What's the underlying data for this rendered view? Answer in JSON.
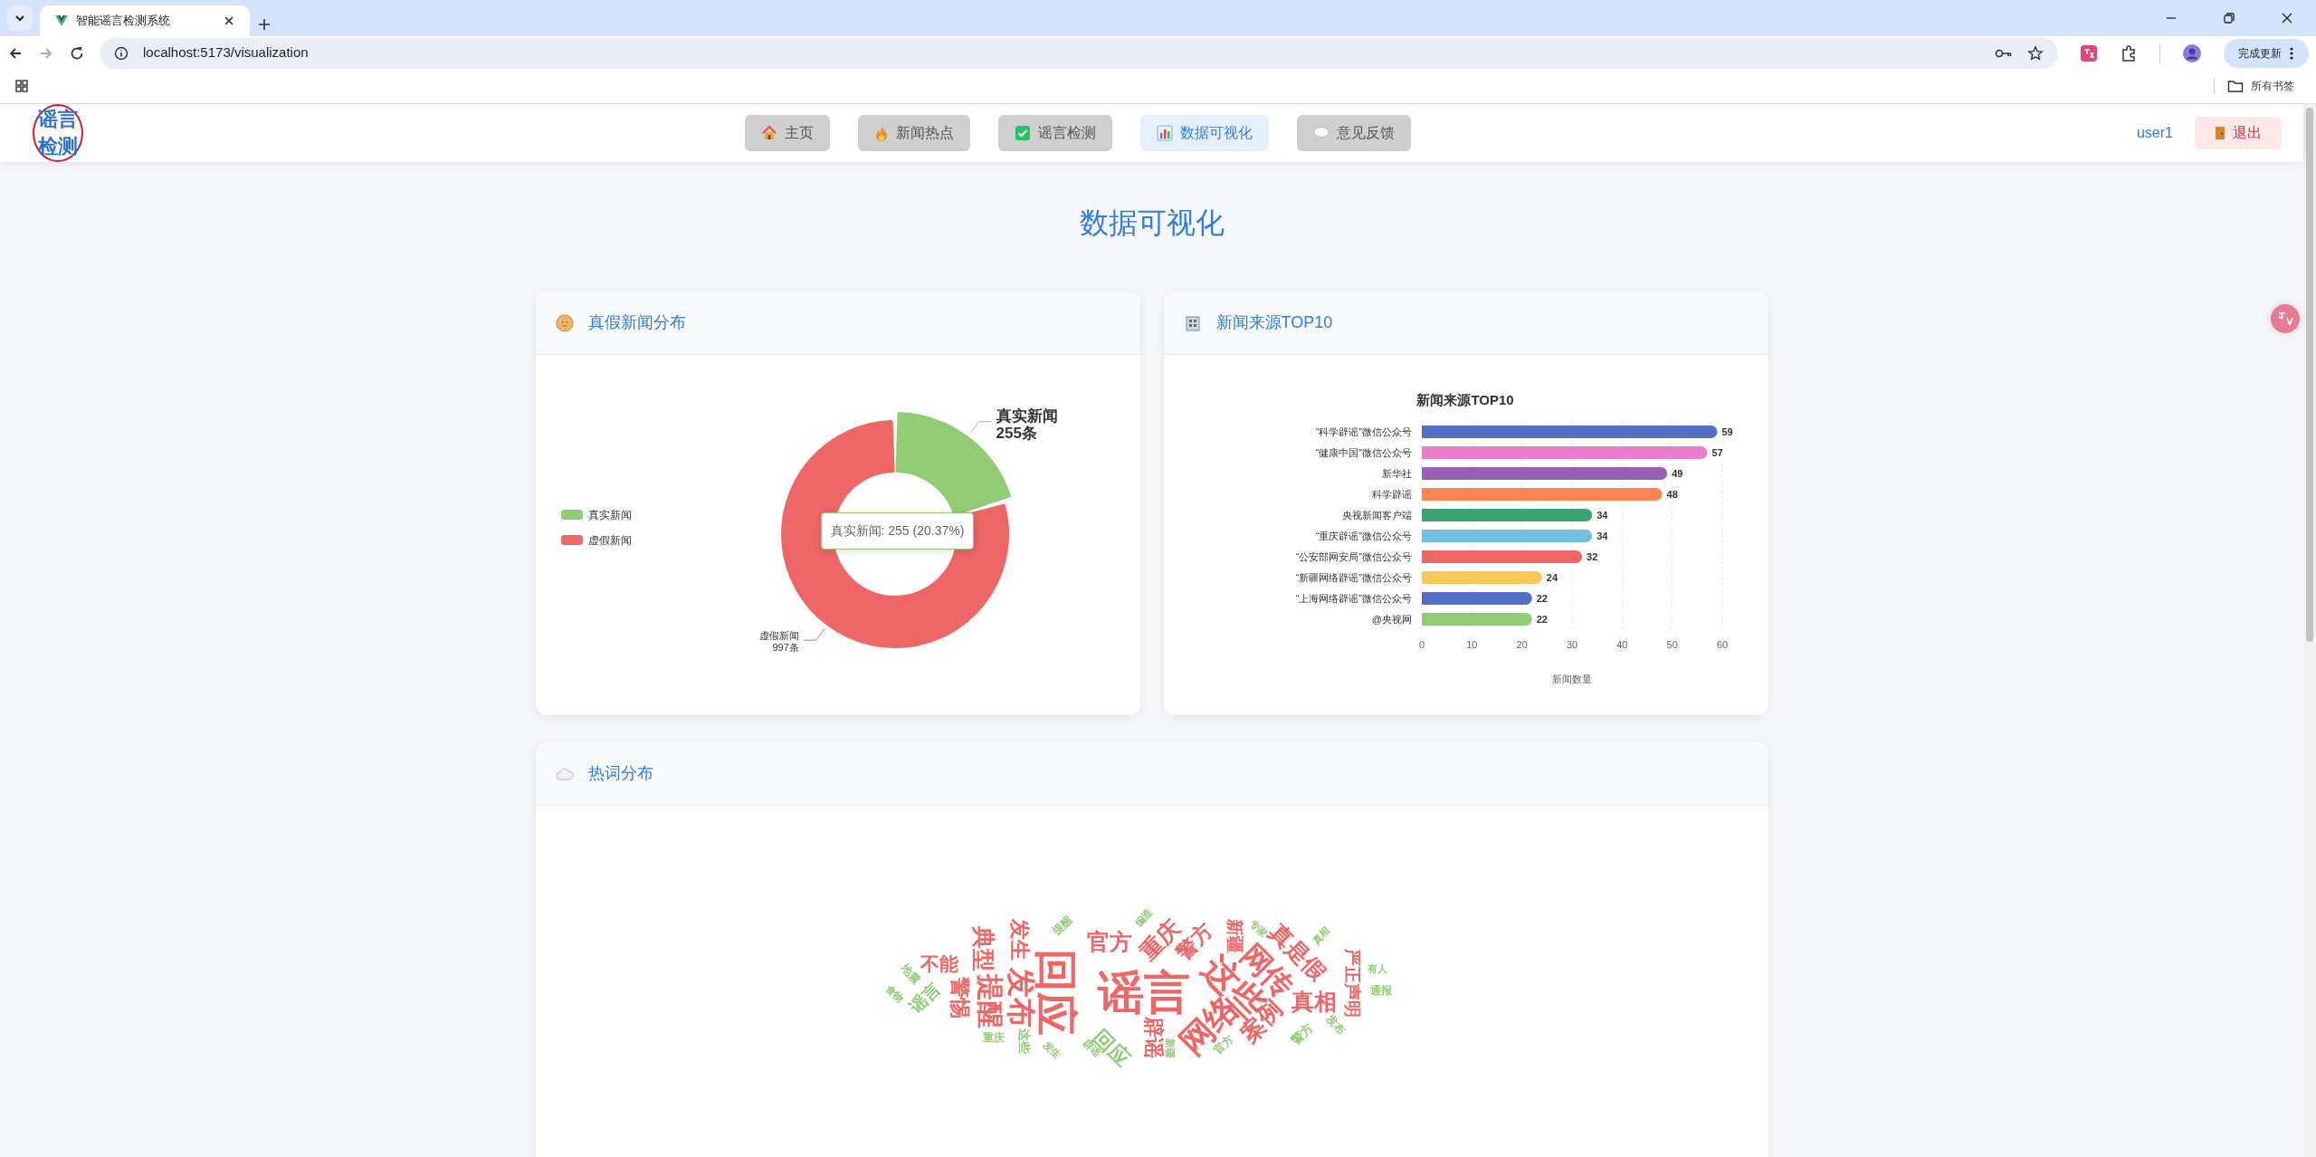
{
  "browser": {
    "tab_title": "智能谣言检测系统",
    "url": "localhost:5173/visualization",
    "update_button": "完成更新",
    "bookmarks_folder": "所有书签"
  },
  "navbar": {
    "logo": "谣言检测",
    "items": [
      {
        "label": "主页",
        "selected": false
      },
      {
        "label": "新闻热点",
        "selected": false
      },
      {
        "label": "谣言检测",
        "selected": false
      },
      {
        "label": "数据可视化",
        "selected": true
      },
      {
        "label": "意见反馈",
        "selected": false
      }
    ],
    "user": "user1",
    "logout": "退出"
  },
  "page_title": "数据可视化",
  "pie_card": {
    "title": "真假新闻分布",
    "slices": [
      {
        "count_label": "255条",
        "hovered": true
      },
      {
        "count_label": "997条",
        "hovered": false
      }
    ],
    "tooltip": "真实新闻: 255 (20.37%)",
    "chart_data": {
      "type": "donut",
      "categories": [
        "真实新闻",
        "虚假新闻"
      ],
      "values": [
        20.37,
        79.63
      ],
      "colors": [
        "#91cc75",
        "#ee6666"
      ]
    },
    "legend": [
      {
        "label": "真实新闻",
        "color": "#91cc75"
      },
      {
        "label": "虚假新闻",
        "color": "#ee6666"
      }
    ]
  },
  "bar_card": {
    "title": "新闻来源TOP10",
    "chart_data": {
      "type": "bar",
      "orientation": "horizontal",
      "title": "新闻来源TOP10",
      "xlabel": "新闻数量",
      "data_labels": true,
      "grid": true,
      "xlim": [
        0,
        60
      ],
      "xticks": [
        0,
        10,
        20,
        30,
        40,
        50,
        60
      ],
      "categories": [
        "“科学辟谣”微信公众号",
        "“健康中国”微信公众号",
        "新华社",
        "科学辟谣",
        "央视新闻客户端",
        "“重庆辟谣”微信公众号",
        "“公安部网安局”微信公众号",
        "“新疆网络辟谣”微信公众号",
        "“上海网络辟谣”微信公众号",
        "@央视网"
      ],
      "colors": [
        "#5470c6",
        "#ea7ccc",
        "#9a60b4",
        "#fc8452",
        "#3ba272",
        "#73c0de",
        "#ee6666",
        "#fac858",
        "#5470c6",
        "#91cc75"
      ],
      "series": [
        {
          "values": [
            59,
            57,
            49,
            48,
            34,
            34,
            32,
            24,
            22,
            22
          ]
        }
      ]
    }
  },
  "cloud_card": {
    "title": "热词分布",
    "words": [
      {
        "text": "食物",
        "color": "#91cc75",
        "kind": "down"
      },
      {
        "text": "地震",
        "color": "#91cc75",
        "kind": "down"
      },
      {
        "text": "谣言",
        "color": "#91cc75",
        "kind": "up"
      },
      {
        "text": "不能",
        "color": "#ee6666",
        "kind": "horizontal"
      },
      {
        "text": "警惕",
        "color": "#ee6666",
        "kind": "vertical"
      },
      {
        "text": "典型",
        "color": "#ee6666",
        "kind": "vertical"
      },
      {
        "text": "提醒",
        "color": "#ee6666",
        "kind": "vertical"
      },
      {
        "text": "重庆",
        "color": "#91cc75",
        "kind": "horizontal"
      },
      {
        "text": "发生",
        "color": "#ee6666",
        "kind": "vertical"
      },
      {
        "text": "发布",
        "color": "#ee6666",
        "kind": "vertical"
      },
      {
        "text": "这些",
        "color": "#91cc75",
        "kind": "vertical"
      },
      {
        "text": "发生",
        "color": "#91cc75",
        "kind": "down"
      },
      {
        "text": "回应",
        "color": "#ee6666",
        "kind": "vertical"
      },
      {
        "text": "提醒",
        "color": "#91cc75",
        "kind": "up"
      },
      {
        "text": "辟谣",
        "color": "#91cc75",
        "kind": "down"
      },
      {
        "text": "官方",
        "color": "#ee6666",
        "kind": "horizontal"
      },
      {
        "text": "回应",
        "color": "#91cc75",
        "kind": "down"
      },
      {
        "text": "谣言",
        "color": "#ee6666",
        "kind": "horizontal"
      },
      {
        "text": "编造",
        "color": "#91cc75",
        "kind": "up"
      },
      {
        "text": "辟谣",
        "color": "#ee6666",
        "kind": "vertical"
      },
      {
        "text": "重庆",
        "color": "#ee6666",
        "kind": "up"
      },
      {
        "text": "新疆",
        "color": "#91cc75",
        "kind": "vertical"
      },
      {
        "text": "警方",
        "color": "#ee6666",
        "kind": "up"
      },
      {
        "text": "网络",
        "color": "#ee6666",
        "kind": "up"
      },
      {
        "text": "官方",
        "color": "#91cc75",
        "kind": "up"
      },
      {
        "text": "这些",
        "color": "#ee6666",
        "kind": "down"
      },
      {
        "text": "新疆",
        "color": "#ee6666",
        "kind": "vertical"
      },
      {
        "text": "专家",
        "color": "#91cc75",
        "kind": "down"
      },
      {
        "text": "案例",
        "color": "#ee6666",
        "kind": "up"
      },
      {
        "text": "网传",
        "color": "#ee6666",
        "kind": "down"
      },
      {
        "text": "真是假",
        "color": "#ee6666",
        "kind": "down"
      },
      {
        "text": "警方",
        "color": "#91cc75",
        "kind": "up"
      },
      {
        "text": "真相",
        "color": "#ee6666",
        "kind": "horizontal"
      },
      {
        "text": "真相",
        "color": "#91cc75",
        "kind": "up"
      },
      {
        "text": "发布",
        "color": "#91cc75",
        "kind": "down"
      },
      {
        "text": "严正声明",
        "color": "#ee6666",
        "kind": "vertical"
      },
      {
        "text": "有人",
        "color": "#91cc75",
        "kind": "horizontal"
      },
      {
        "text": "通报",
        "color": "#91cc75",
        "kind": "horizontal"
      }
    ]
  }
}
